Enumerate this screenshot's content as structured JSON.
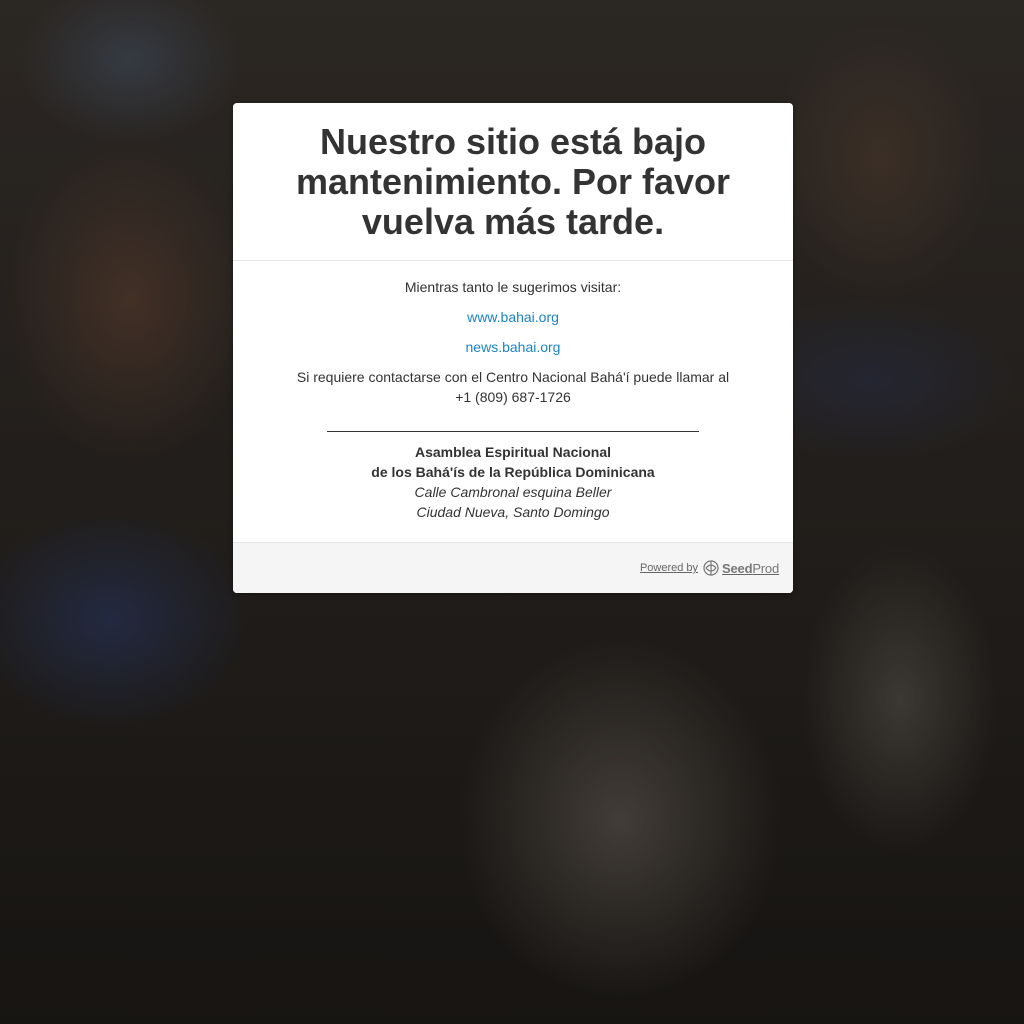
{
  "page": {
    "headline": "Nuestro sitio está bajo mantenimiento. Por favor vuelva más tarde."
  },
  "content": {
    "intro": "Mientras tanto le sugerimos visitar:",
    "links": [
      {
        "label": "www.bahai.org"
      },
      {
        "label": "news.bahai.org"
      }
    ],
    "contact_line1": "Si requiere contactarse con el Centro Nacional Bahá'í puede llamar al",
    "contact_phone": "+1 (809) 687-1726",
    "org": {
      "name_line1": "Asamblea Espiritual Nacional",
      "name_line2": "de los Bahá'ís de la República Dominicana",
      "address_line1": "Calle Cambronal esquina Beller",
      "address_line2": "Ciudad Nueva, Santo Domingo"
    }
  },
  "footer": {
    "powered_by": "Powered by",
    "brand_part1": "Seed",
    "brand_part2": "Prod",
    "icon": "seedprod-logo-icon"
  },
  "colors": {
    "link": "#1b84c8",
    "text": "#333333",
    "footer_bg": "#f5f5f5"
  }
}
